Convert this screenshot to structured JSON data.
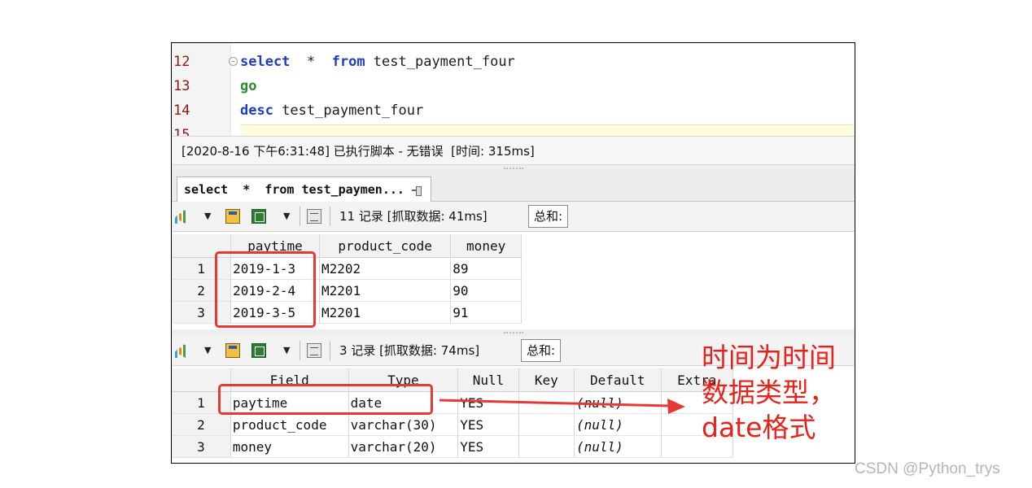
{
  "editor": {
    "lines": [
      {
        "num": "12",
        "tokens": [
          {
            "t": "select",
            "c": "kw"
          },
          {
            "t": "  *  ",
            "c": "id"
          },
          {
            "t": "from",
            "c": "kw"
          },
          {
            "t": " test_payment_four",
            "c": "id"
          }
        ]
      },
      {
        "num": "13",
        "tokens": [
          {
            "t": "go",
            "c": "kw-go"
          }
        ]
      },
      {
        "num": "14",
        "tokens": [
          {
            "t": "desc",
            "c": "kw"
          },
          {
            "t": " test_payment_four",
            "c": "id"
          }
        ]
      },
      {
        "num": "15",
        "tokens": []
      }
    ]
  },
  "status": {
    "message": "[2020-8-16 下午6:31:48] 已执行脚本 - 无错误  [时间: 315ms]"
  },
  "result_tab": {
    "label": "select  *  from test_paymen..."
  },
  "result1": {
    "records": "11 记录 [抓取数据: 41ms]",
    "sum_label": "总和:",
    "columns": [
      "paytime",
      "product_code",
      "money"
    ],
    "rows": [
      {
        "num": "1",
        "cells": [
          "2019-1-3",
          "M2202",
          "89"
        ]
      },
      {
        "num": "2",
        "cells": [
          "2019-2-4",
          "M2201",
          "90"
        ]
      },
      {
        "num": "3",
        "cells": [
          "2019-3-5",
          "M2201",
          "91"
        ]
      }
    ]
  },
  "result2": {
    "records": "3 记录 [抓取数据: 74ms]",
    "sum_label": "总和:",
    "columns": [
      "Field",
      "Type",
      "Null",
      "Key",
      "Default",
      "Extra"
    ],
    "rows": [
      {
        "num": "1",
        "cells": [
          "paytime",
          "date",
          "YES",
          "",
          "(null)",
          ""
        ]
      },
      {
        "num": "2",
        "cells": [
          "product_code",
          "varchar(30)",
          "YES",
          "",
          "(null)",
          ""
        ]
      },
      {
        "num": "3",
        "cells": [
          "money",
          "varchar(20)",
          "YES",
          "",
          "(null)",
          ""
        ]
      }
    ]
  },
  "annotation": {
    "lines": [
      "时间为时间",
      "数据类型，",
      "date格式"
    ],
    "color": "#e6221b"
  },
  "watermark": "CSDN @Python_trys",
  "icons": [
    "bar-chart-icon",
    "grid-view-icon",
    "excel-export-icon",
    "script-icon",
    "pin-icon"
  ]
}
